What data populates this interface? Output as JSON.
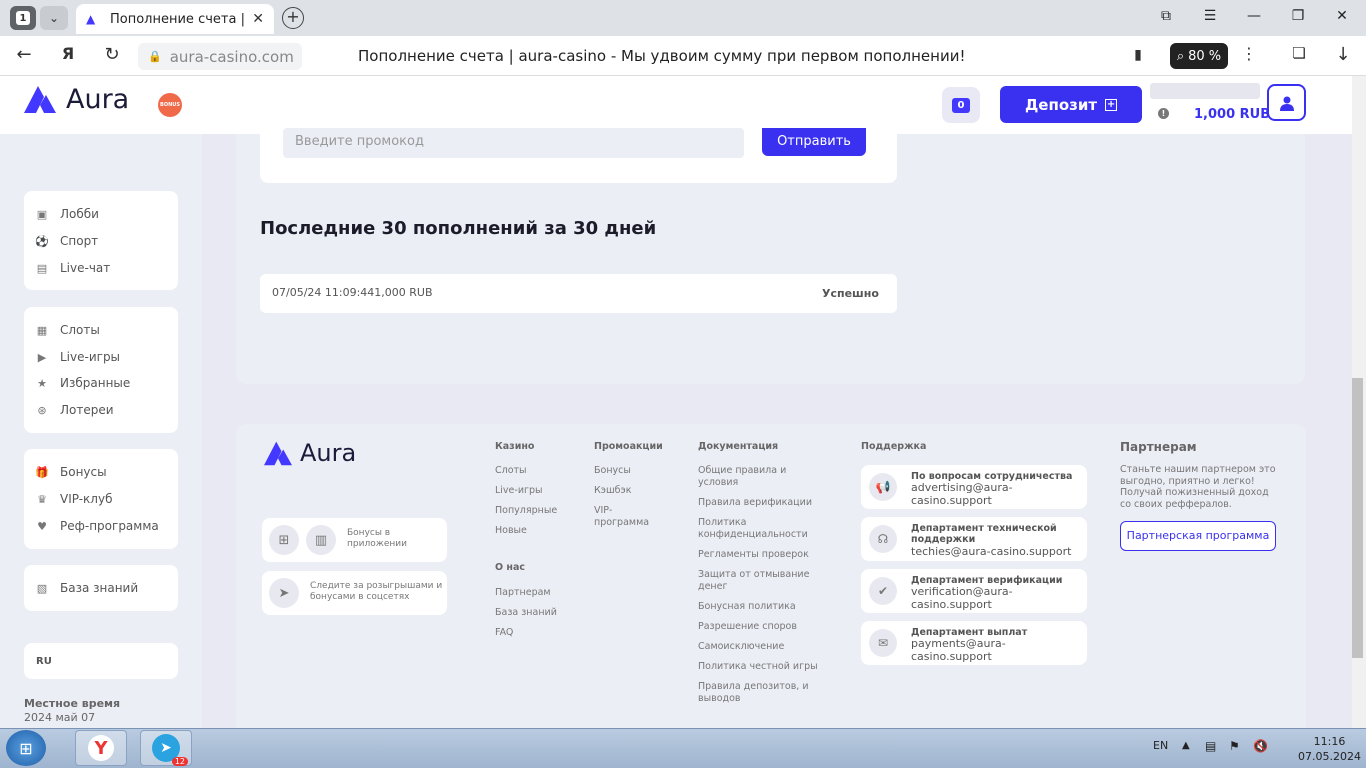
{
  "browser": {
    "tab_count": "1",
    "tab_title": "Пополнение счета | aura-casino",
    "url": "aura-casino.com",
    "page_title": "Пополнение счета | aura-casino - Мы удвоим сумму при первом пополнении!",
    "zoom": "80 %"
  },
  "header": {
    "logo_text": "Aura",
    "bonus_badge": "BONUS",
    "chat_count": "0",
    "deposit_label": "Депозит",
    "balance": "1,000 RUB"
  },
  "sidebar": {
    "group1": [
      "Лобби",
      "Спорт",
      "Live-чат"
    ],
    "group2": [
      "Слоты",
      "Live-игры",
      "Избранные",
      "Лотереи"
    ],
    "group3": [
      "Бонусы",
      "VIP-клуб",
      "Реф-программа"
    ],
    "group4": [
      "База знаний"
    ],
    "language": "RU",
    "local_time_label": "Местное время",
    "local_time_value": "2024 май 07"
  },
  "main": {
    "promo_placeholder": "Введите промокод",
    "send_label": "Отправить",
    "history_title": "Последние 30 пополнений за 30 дней",
    "history_row_text": "07/05/24 11:09:441,000 RUB",
    "history_row_status": "Успешно"
  },
  "footer": {
    "logo_text": "Aura",
    "app_text": "Бонусы в приложении",
    "social_text": "Следите за розыгрышами и бонусами в соцсетях",
    "casino": {
      "title": "Казино",
      "links": [
        "Слоты",
        "Live-игры",
        "Популярные",
        "Новые"
      ]
    },
    "about": {
      "title": "О нас",
      "links": [
        "Партнерам",
        "База знаний",
        "FAQ"
      ]
    },
    "promo": {
      "title": "Промоакции",
      "links": [
        "Бонусы",
        "Кэшбэк",
        "VIP-программа"
      ]
    },
    "docs": {
      "title": "Документация",
      "links": [
        "Общие правила и условия",
        "Правила верификации",
        "Политика конфиденциальности",
        "Регламенты проверок",
        "Защита от отмывание денег",
        "Бонусная политика",
        "Разрешение споров",
        "Самоисключение",
        "Политика честной игры",
        "Правила депозитов, и выводов"
      ]
    },
    "support": {
      "title": "Поддержка",
      "items": [
        {
          "title": "По вопросам сотрудничества",
          "email": "advertising@aura-casino.support"
        },
        {
          "title": "Департамент технической поддержки",
          "email": "techies@aura-casino.support"
        },
        {
          "title": "Департамент верификации",
          "email": "verification@aura-casino.support"
        },
        {
          "title": "Департамент выплат",
          "email": "payments@aura-casino.support"
        }
      ]
    },
    "partners": {
      "title": "Партнерам",
      "text": "Станьте нашим партнером это выгодно, приятно и легко! Получай пожизненный доход со своих реффералов.",
      "button": "Партнерская программа"
    }
  },
  "taskbar": {
    "telegram_badge": "12",
    "lang": "EN",
    "time": "11:16",
    "date": "07.05.2024"
  },
  "colors": {
    "accent": "#3a31f0",
    "bonus": "#f06a4a",
    "background": "#e8e9f3"
  }
}
